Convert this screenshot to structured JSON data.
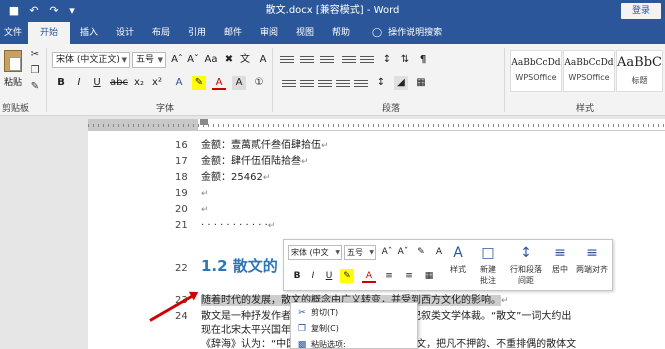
{
  "titlebar": {
    "title": "散文.docx [兼容模式] - Word",
    "login": "登录",
    "quick_access": [
      "save-icon",
      "undo-icon",
      "redo-icon",
      "customize-icon"
    ]
  },
  "tabs": [
    "文件",
    "开始",
    "插入",
    "设计",
    "布局",
    "引用",
    "邮件",
    "审阅",
    "视图",
    "帮助"
  ],
  "tell_me": "操作说明搜索",
  "ribbon": {
    "clipboard": {
      "paste": "粘贴",
      "label": "剪贴板"
    },
    "font": {
      "name": "宋体 (中文正文)",
      "size": "五号",
      "label": "字体"
    },
    "paragraph": {
      "label": "段落"
    },
    "styles": {
      "label": "样式",
      "items": [
        {
          "sample": "AaBbCcDd",
          "name": "WPSOffice"
        },
        {
          "sample": "AaBbCcDd",
          "name": "WPSOffice"
        },
        {
          "sample": "AaBbC",
          "name": "标题"
        }
      ]
    }
  },
  "document": {
    "lines": [
      {
        "num": "16",
        "text": "金额：壹萬貳仟叁佰肆拾伍"
      },
      {
        "num": "17",
        "text": "金额：肆仟伍佰陆拾叁"
      },
      {
        "num": "18",
        "text": "金额：25462"
      },
      {
        "num": "19",
        "text": ""
      },
      {
        "num": "20",
        "text": ""
      },
      {
        "num": "21",
        "text": "· · · · · · · · · · ·"
      },
      {
        "num": "22",
        "text": "1.2 散文的"
      },
      {
        "num": "23",
        "text": "随着时代的发展，散文的概念由广义转变，并受到西方文化的影响。"
      },
      {
        "num": "24",
        "text": "散文是一种抒发作者真情实感、写作方式灵活的记叙类文学体裁。“散文”一词大约出"
      },
      {
        "num": "",
        "text": "现在北宋太平兴国年间，"
      },
      {
        "num": "",
        "text": "《辞海》认为：“中国六朝以来，为区别韵文与骈文，把凡不押韵、不重排偶的散体文"
      }
    ]
  },
  "mini_toolbar": {
    "font": "宋体 (中文",
    "size": "五号",
    "styles": "样式",
    "new_comment": [
      "新建",
      "批注"
    ],
    "line_spacing": [
      "行和段落",
      "间距"
    ],
    "center": "居中",
    "justify": "两端对齐"
  },
  "context_menu": [
    {
      "icon": "scissors-icon",
      "label": "剪切(T)"
    },
    {
      "icon": "copy-icon",
      "label": "复制(C)"
    },
    {
      "icon": "clipboard-icon",
      "label": "粘贴选项:"
    }
  ],
  "colors": {
    "title_bar": "#2b579a",
    "ribbon_bg": "#f3f3f3",
    "heading": "#2e75b6",
    "arrow": "#d00000"
  }
}
